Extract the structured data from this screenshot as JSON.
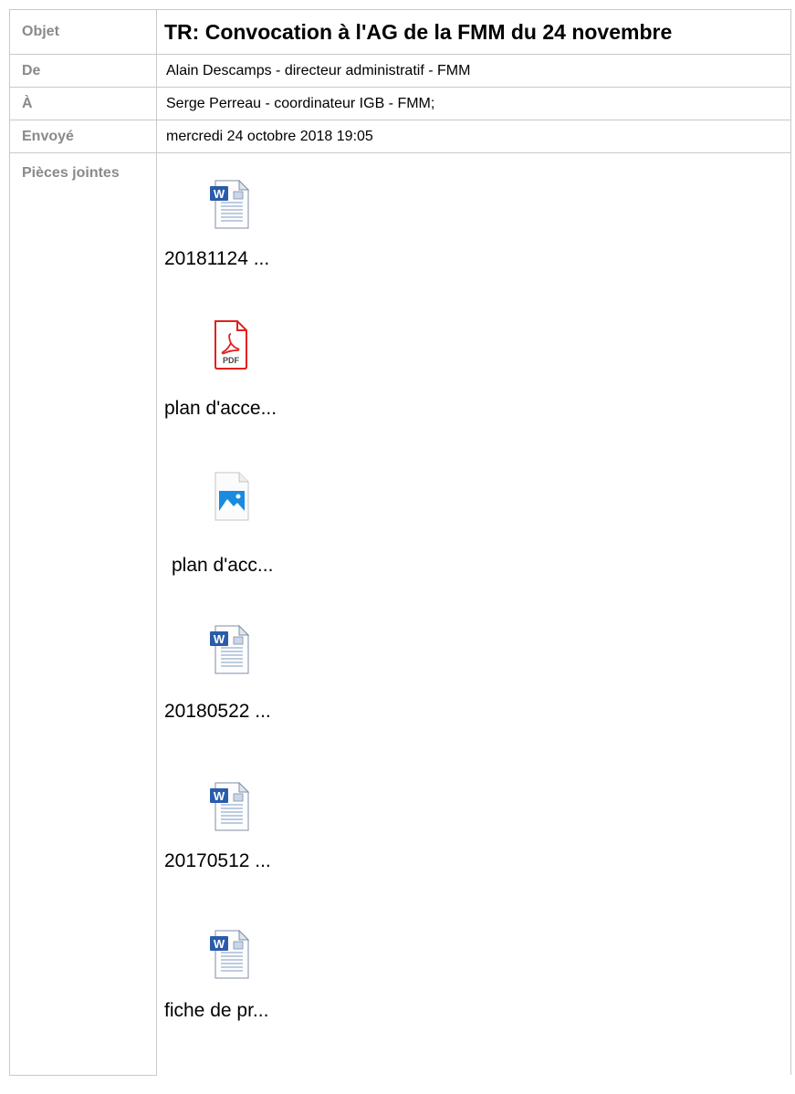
{
  "header": {
    "subject_label": "Objet",
    "subject": "TR: Convocation à l'AG de la FMM du 24 novembre",
    "from_label": "De",
    "from": "Alain Descamps - directeur administratif - FMM",
    "to_label": "À",
    "to": "Serge Perreau - coordinateur IGB - FMM;",
    "sent_label": "Envoyé",
    "sent": "mercredi 24 octobre 2018 19:05",
    "attachments_label": "Pièces jointes"
  },
  "attachments": [
    {
      "name": "20181124 ...",
      "icon": "word-document-icon"
    },
    {
      "name": "plan d'acce...",
      "icon": "pdf-file-icon"
    },
    {
      "name": "plan d'acc...",
      "icon": "image-file-icon"
    },
    {
      "name": "20180522 ...",
      "icon": "word-document-icon"
    },
    {
      "name": "20170512 ...",
      "icon": "word-document-icon"
    },
    {
      "name": "fiche de pr...",
      "icon": "word-document-icon"
    }
  ],
  "colors": {
    "label_text": "#8a8a8a",
    "border": "#c9c9c9",
    "word_blue": "#2a5caa",
    "pdf_red": "#e02020",
    "image_blue": "#1a8be0"
  }
}
